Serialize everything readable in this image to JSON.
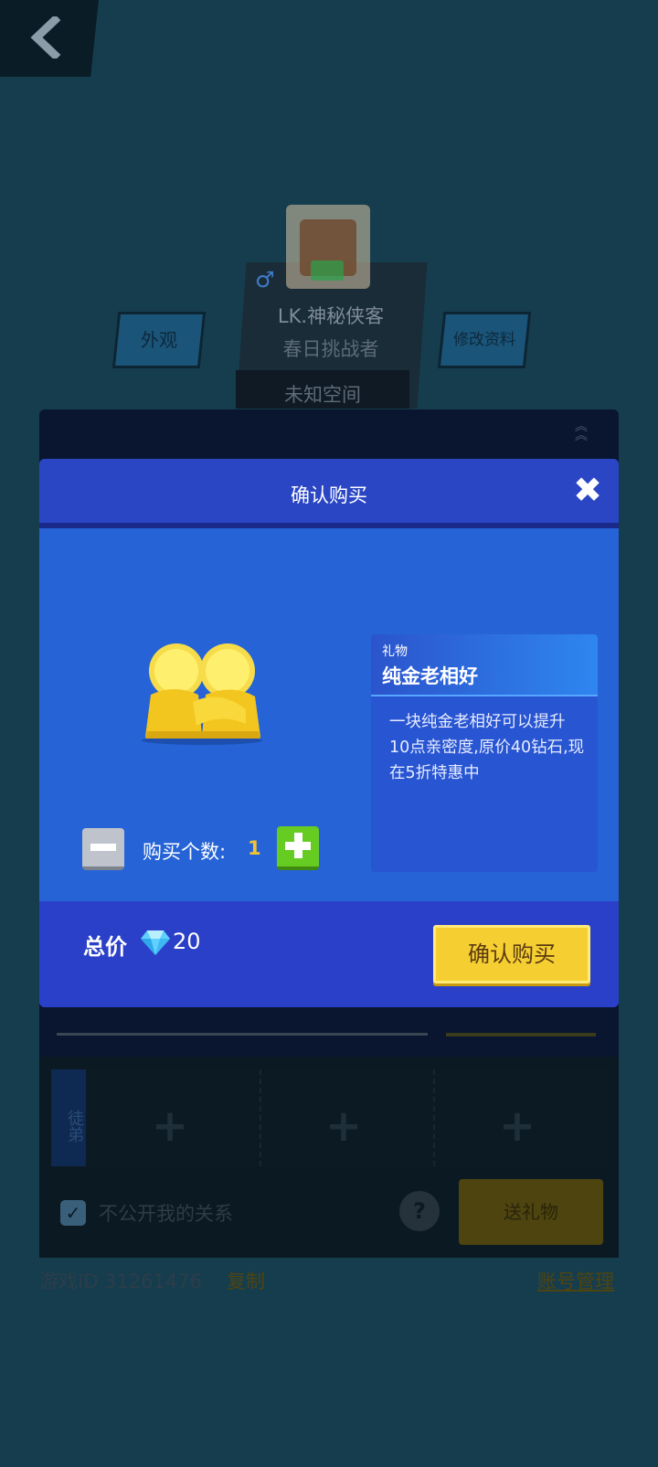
{
  "header": {
    "back_icon": "chevron-left-icon"
  },
  "profile": {
    "gender_symbol": "♂",
    "name": "LK.神秘侠客",
    "title": "春日挑战者",
    "location": "未知空间",
    "appearance_button": "外观",
    "edit_profile_button": "修改资料"
  },
  "relations": {
    "slot_label": "徒弟",
    "slot_plus": "+",
    "hide_relation_label": "不公开我的关系",
    "checkbox_mark": "✓",
    "help_symbol": "?",
    "send_gift_button": "送礼物",
    "game_id": "游戏ID 31261476",
    "copy_link": "复制",
    "account_link": "账号管理"
  },
  "modal": {
    "title": "确认购买",
    "close_symbol": "✖",
    "gift_tag": "礼物",
    "gift_name": "纯金老相好",
    "gift_description": "一块纯金老相好可以提升10点亲密度,原价40钻石,现在5折特惠中",
    "quantity_label": "购买个数:",
    "quantity": "1",
    "total_label": "总价",
    "total_value": "20",
    "confirm_button": "确认购买",
    "icons": [
      "gift-gold-icon",
      "diamond-icon",
      "minus-icon",
      "plus-icon",
      "close-icon"
    ]
  },
  "colors": {
    "modal_body": "#2563d6",
    "modal_header": "#2a46c4",
    "confirm_yellow": "#f5cf32",
    "quantity_highlight": "#f2c431",
    "plus_green": "#66cc22"
  }
}
